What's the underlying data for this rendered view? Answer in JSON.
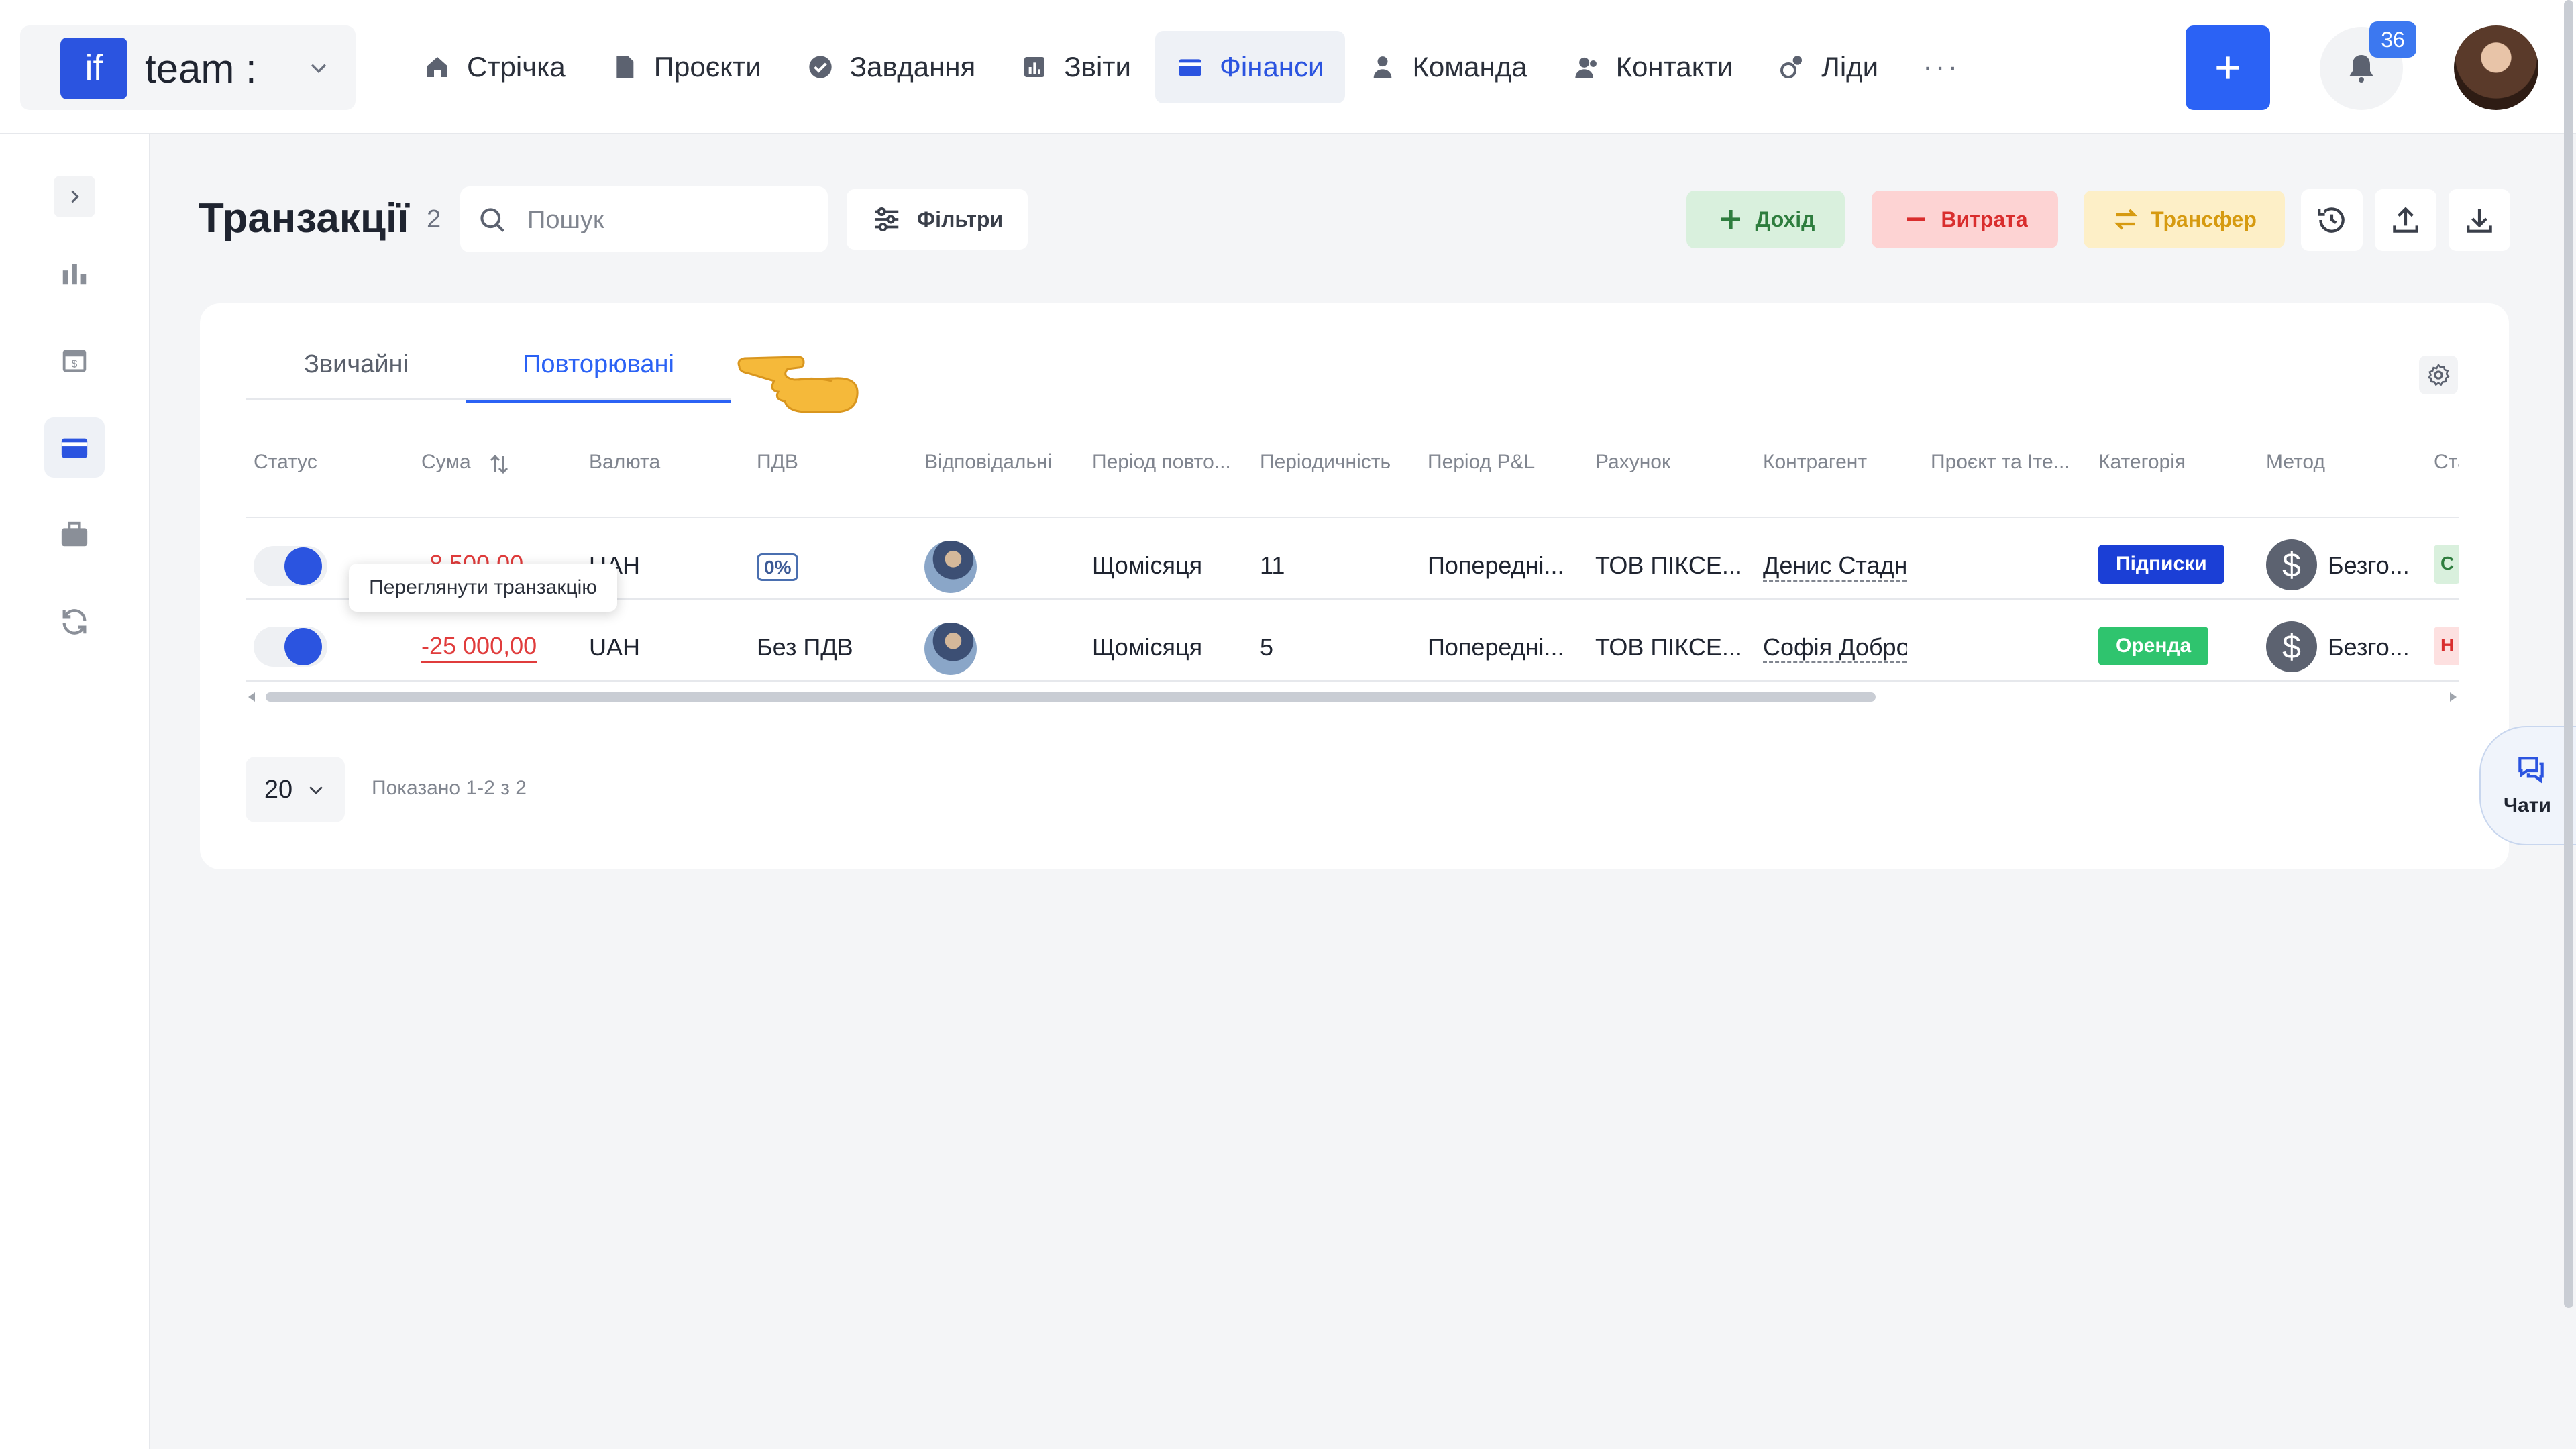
{
  "workspace": {
    "logo_text": "if",
    "name": "team :"
  },
  "nav": [
    {
      "label": "Стрічка",
      "icon": "home-icon"
    },
    {
      "label": "Проєкти",
      "icon": "document-icon"
    },
    {
      "label": "Завдання",
      "icon": "check-circle-icon"
    },
    {
      "label": "Звіти",
      "icon": "report-icon"
    },
    {
      "label": "Фінанси",
      "icon": "wallet-icon",
      "active": true
    },
    {
      "label": "Команда",
      "icon": "person-icon"
    },
    {
      "label": "Контакти",
      "icon": "contacts-icon"
    },
    {
      "label": "Ліди",
      "icon": "leads-icon"
    }
  ],
  "nav_more": "···",
  "notifications": {
    "count": "36"
  },
  "page": {
    "title": "Транзакції",
    "count": "2"
  },
  "search": {
    "placeholder": "Пошук"
  },
  "filters_label": "Фільтри",
  "actions": {
    "income": "Дохід",
    "expense": "Витрата",
    "transfer": "Трансфер"
  },
  "tabs": {
    "regular": "Звичайні",
    "recurring": "Повторювані",
    "active": "recurring"
  },
  "columns": [
    "Статус",
    "Сума",
    "Валюта",
    "ПДВ",
    "Відповідальні",
    "Період повто...",
    "Періодичність",
    "Період P&L",
    "Рахунок",
    "Контрагент",
    "Проєкт та Іте...",
    "Категорія",
    "Метод",
    "Ста"
  ],
  "rows": [
    {
      "status_on": true,
      "amount": "-8 500,00",
      "currency": "UAH",
      "vat": "0%",
      "repeat_period": "Щомісяця",
      "periodicity": "11",
      "pl_period": "Попередні...",
      "account": "ТОВ ПІКСЕ...",
      "counterparty": "Денис Стадн",
      "project": "",
      "category": "Підписки",
      "method": "Безго...",
      "state": "С"
    },
    {
      "status_on": true,
      "amount": "-25 000,00",
      "currency": "UAH",
      "vat": "Без ПДВ",
      "repeat_period": "Щомісяця",
      "periodicity": "5",
      "pl_period": "Попередні...",
      "account": "ТОВ ПІКСЕ...",
      "counterparty": "Софія Добро",
      "project": "",
      "category": "Оренда",
      "method": "Безго...",
      "state": "Н"
    }
  ],
  "tooltip": "Переглянути транзакцію",
  "pagination": {
    "page_size": "20",
    "shown": "Показано 1-2 з 2"
  },
  "chat": {
    "label": "Чати"
  },
  "colors": {
    "accent": "#2b62f5",
    "negative": "#e03c3c",
    "category_subscriptions": "#1b3fd6",
    "category_rent": "#2fc46e",
    "income_bg": "#d9f0dd",
    "expense_bg": "#fdd3d3",
    "transfer_bg": "#fdefc7"
  }
}
